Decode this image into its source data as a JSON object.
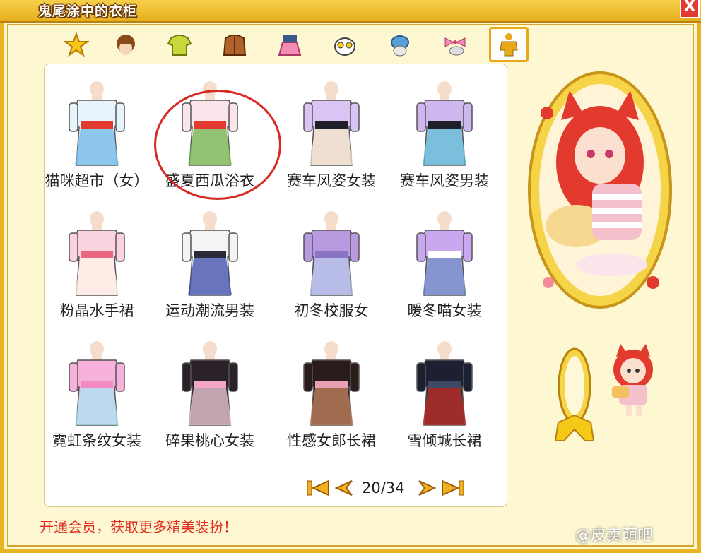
{
  "window": {
    "title": "鬼尾涂中的衣柜",
    "close_label": "X"
  },
  "tabs": [
    {
      "icon": "star-icon",
      "name": "favorites"
    },
    {
      "icon": "hair-icon",
      "name": "hair"
    },
    {
      "icon": "shirt-icon",
      "name": "top"
    },
    {
      "icon": "jacket-icon",
      "name": "coat"
    },
    {
      "icon": "skirt-icon",
      "name": "bottom"
    },
    {
      "icon": "face-icon",
      "name": "face"
    },
    {
      "icon": "hat-icon",
      "name": "hat"
    },
    {
      "icon": "bow-icon",
      "name": "accessory"
    },
    {
      "icon": "outfit-icon",
      "name": "suit",
      "active": true
    }
  ],
  "items": [
    {
      "label": "猫咪超市（女）",
      "colors": [
        "#e8f4fb",
        "#e23a2e",
        "#6fb8e8"
      ]
    },
    {
      "label": "盛夏西瓜浴衣",
      "colors": [
        "#fbe4ea",
        "#e23a2e",
        "#6db84a"
      ]
    },
    {
      "label": "赛车风姿女装",
      "colors": [
        "#d9c4f4",
        "#1f1f2a",
        "#f5e8c8"
      ]
    },
    {
      "label": "赛车风姿男装",
      "colors": [
        "#cfb7ef",
        "#1f1f2a",
        "#5ec3d6"
      ]
    },
    {
      "label": "粉晶水手裙",
      "colors": [
        "#fbd3df",
        "#e8667f",
        "#fff6e8"
      ]
    },
    {
      "label": "运动潮流男装",
      "colors": [
        "#f4f4f4",
        "#2a2a3a",
        "#3a4aa8"
      ]
    },
    {
      "label": "初冬校服女",
      "colors": [
        "#b89ae0",
        "#8a73c4",
        "#b7c8e8"
      ]
    },
    {
      "label": "暖冬喵女装",
      "colors": [
        "#c9a8ef",
        "#ffffff",
        "#6d8fc4"
      ]
    },
    {
      "label": "霓虹条纹女装",
      "colors": [
        "#f7b2dc",
        "#f28ac4",
        "#a8e6f4"
      ]
    },
    {
      "label": "碎果桃心女装",
      "colors": [
        "#2a2228",
        "#f3a7c4",
        "#f6d0dd"
      ]
    },
    {
      "label": "性感女郎长裙",
      "colors": [
        "#2b1c1c",
        "#e8a0b4",
        "#c98660"
      ]
    },
    {
      "label": "雪倾城长裙",
      "colors": [
        "#1d2030",
        "#3c4a66",
        "#c8302a"
      ]
    }
  ],
  "pager": {
    "text": "20/34"
  },
  "promo_text": "开通会员，获取更多精美装扮！",
  "watermark": "@皮卖萌吧",
  "accent_colors": {
    "gold": "#e8b422",
    "red": "#d62a22"
  }
}
